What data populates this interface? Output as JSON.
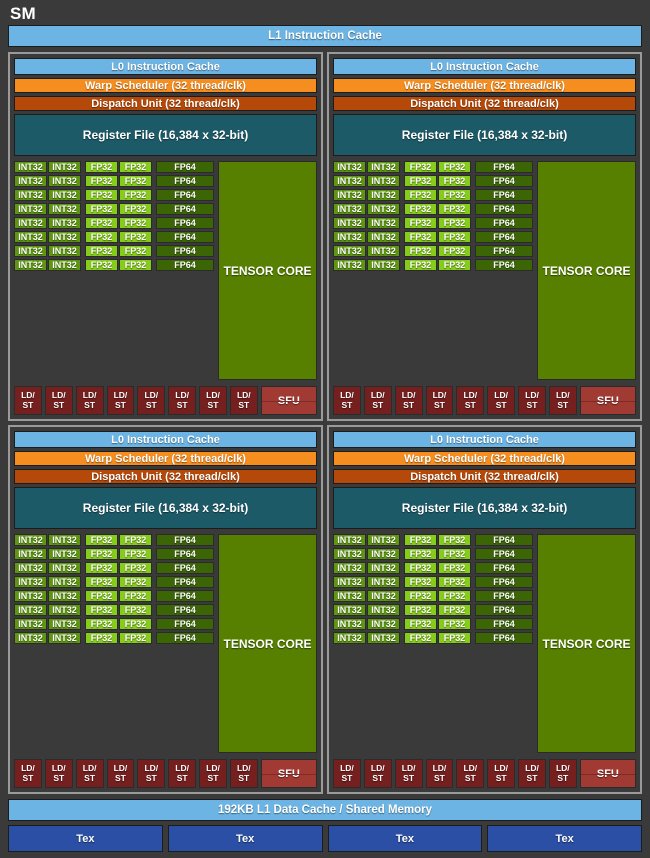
{
  "diagram": {
    "title": "SM",
    "l1_instruction_cache": "L1 Instruction Cache",
    "l1_data_cache": "192KB L1 Data Cache / Shared Memory"
  },
  "processing_block": {
    "l0_instruction_cache": "L0 Instruction Cache",
    "warp_scheduler": "Warp Scheduler (32 thread/clk)",
    "dispatch_unit": "Dispatch Unit (32 thread/clk)",
    "register_file": "Register File (16,384 x 32-bit)",
    "tensor_core": "TENSOR CORE",
    "int32": "INT32",
    "fp32": "FP32",
    "fp64": "FP64",
    "ldst_line1": "LD/",
    "ldst_line2": "ST",
    "sfu": "SFU",
    "core_rows": 8,
    "int32_per_row": 2,
    "fp32_per_row": 2,
    "fp64_per_row": 1,
    "ldst_count": 8,
    "sfu_count": 1
  },
  "texture_units": [
    {
      "label": "Tex"
    },
    {
      "label": "Tex"
    },
    {
      "label": "Tex"
    },
    {
      "label": "Tex"
    }
  ],
  "quadrant_count": 4,
  "colors": {
    "chip_background": "#3a3a3a",
    "quadrant_border": "#9a9a9a",
    "instruction_cache": "#6cb4e4",
    "warp_scheduler": "#f68d1f",
    "dispatch_unit": "#b5490a",
    "register_file": "#1d5a68",
    "int32": "#5e9612",
    "fp32": "#86cc1b",
    "fp64": "#3c6606",
    "tensor_core": "#578000",
    "ldst": "#751f1f",
    "sfu": "#a03a33",
    "tex": "#2a4fa5",
    "text": "#ffffff"
  }
}
